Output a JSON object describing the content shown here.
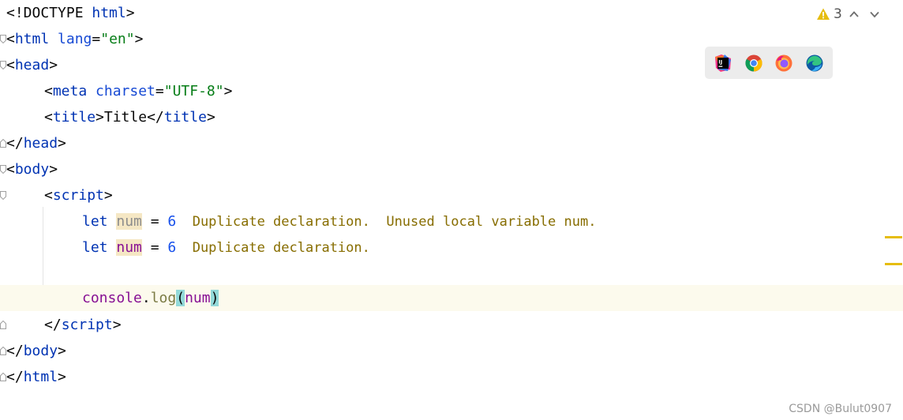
{
  "status": {
    "warning_count": "3",
    "warning_icon": "warning-triangle-icon",
    "prev_icon": "chevron-up-icon",
    "next_icon": "chevron-down-icon",
    "accent": "#e6bd0f"
  },
  "browsers": [
    {
      "name": "intellij-icon"
    },
    {
      "name": "chrome-icon"
    },
    {
      "name": "firefox-icon"
    },
    {
      "name": "edge-icon"
    }
  ],
  "code": {
    "l1": {
      "a": "<!DOCTYPE ",
      "b": "html",
      "c": ">"
    },
    "l2": {
      "a": "<",
      "b": "html ",
      "c": "lang",
      "d": "=",
      "e": "\"en\"",
      "f": ">"
    },
    "l3": {
      "a": "<",
      "b": "head",
      "c": ">"
    },
    "l4": {
      "a": "<",
      "b": "meta ",
      "c": "charset",
      "d": "=",
      "e": "\"UTF-8\"",
      "f": ">"
    },
    "l5": {
      "a": "<",
      "b": "title",
      "c": ">",
      "d": "Title",
      "e": "</",
      "f": "title",
      "g": ">"
    },
    "l6": {
      "a": "</",
      "b": "head",
      "c": ">"
    },
    "l7": {
      "a": "<",
      "b": "body",
      "c": ">"
    },
    "l8": {
      "a": "<",
      "b": "script",
      "c": ">"
    },
    "l9": {
      "kw": "let ",
      "var": "num",
      "eq": " = ",
      "num": "6",
      "hint": "  Duplicate declaration.  Unused local variable num."
    },
    "l10": {
      "kw": "let ",
      "var": "num",
      "eq": " = ",
      "num": "6",
      "hint": "  Duplicate declaration."
    },
    "l12": {
      "obj": "console",
      "dot": ".",
      "fn": "log",
      "open": "(",
      "arg": "num",
      "close": ")"
    },
    "l13": {
      "a": "</",
      "b": "script",
      "c": ">"
    },
    "l14": {
      "a": "</",
      "b": "body",
      "c": ">"
    },
    "l15": {
      "a": "</",
      "b": "html",
      "c": ">"
    }
  },
  "watermark": "CSDN @Bulut0907"
}
